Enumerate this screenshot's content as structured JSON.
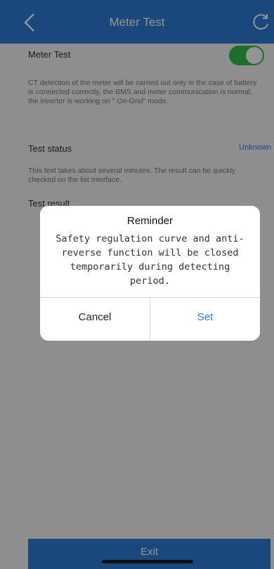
{
  "header": {
    "title": "Meter Test",
    "back_icon": "chevron-left-icon",
    "refresh_icon": "refresh-icon"
  },
  "meter_test": {
    "label": "Meter Test",
    "toggle_on": true,
    "description": "CT detection of the meter will be carried out only in the case of battery is connected correctly, the BMS and meter communication is normal, the inverter is working on \" On-Grid\" mode."
  },
  "test_status": {
    "label": "Test status",
    "value": "Unknown",
    "description": "This test takes about several minutes. The result can be quickly checked on the list interface."
  },
  "test_result": {
    "label": "Test result"
  },
  "dialog": {
    "title": "Reminder",
    "message": "Safety regulation curve and anti-reverse function will be closed temporarily during detecting period.",
    "cancel_label": "Cancel",
    "set_label": "Set"
  },
  "footer": {
    "exit_label": "Exit"
  },
  "colors": {
    "accent": "#2e7cd6",
    "toggle_on": "#2fbf4a"
  }
}
